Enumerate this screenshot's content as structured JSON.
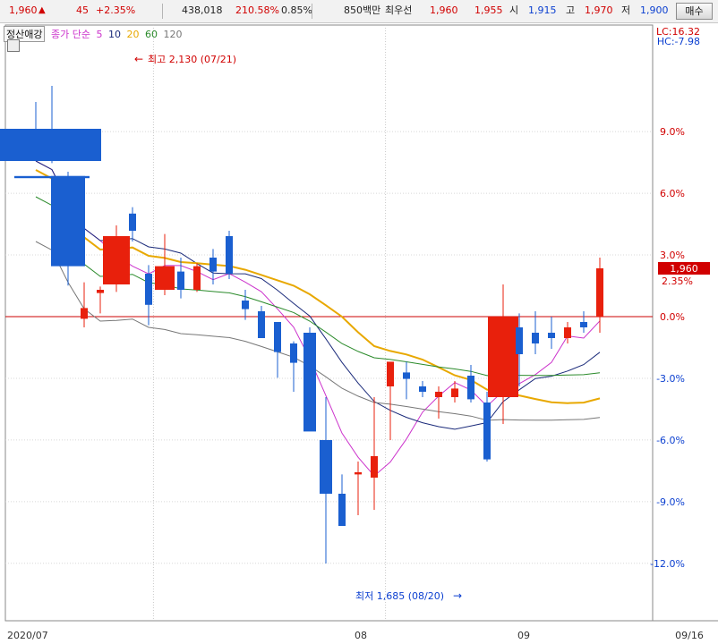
{
  "header": {
    "price": "1,960",
    "up_icon": "up-triangle-icon",
    "change": "45",
    "change_pct": "+2.35%",
    "volume": "438,018",
    "volume_ratio": "210.58%",
    "turnover": "0.85%",
    "amount": "850백만",
    "best_bid_label": "최우선",
    "best_ask": "1,960",
    "best_bid": "1,955",
    "open_label": "시",
    "open": "1,915",
    "high_label": "고",
    "high": "1,970",
    "low_label": "저",
    "low": "1,900",
    "buy_button": "매수"
  },
  "legend": {
    "selector": "정산애강",
    "ma_label": "종가 단순",
    "ma5": "5",
    "ma10": "10",
    "ma20": "20",
    "ma60": "60",
    "ma120": "120"
  },
  "colors": {
    "up": "#e8200c",
    "down": "#1a5fd0",
    "ma5": "#cc33cc",
    "ma10": "#1a2a7a",
    "ma20": "#e8a800",
    "ma60": "#2a8a2a",
    "ma120": "#777777",
    "ref_line": "#cc0000"
  },
  "chart_data": {
    "type": "candlestick",
    "right_axis_ticks": [
      "9.0%",
      "6.0%",
      "3.0%",
      "0.0%",
      "-3.0%",
      "-6.0%",
      "-9.0%",
      "-12.0%"
    ],
    "x_labels": [
      "2020/07",
      "08",
      "09",
      "09/16"
    ],
    "lc_label": "LC:16.32",
    "hc_label": "HC:-7.98",
    "current_price_label": "1,960",
    "current_pct_label": "2.35%",
    "ref_price": 1915,
    "price_max_annotation": "최고 2,130 (07/21)",
    "price_min_annotation": "최저 1,685 (08/20)",
    "candles": [
      {
        "o": 2090,
        "h": 2115,
        "l": 2060,
        "c": 2060
      },
      {
        "o": 2046,
        "h": 2130,
        "l": 2058,
        "c": 2044
      },
      {
        "o": 2046,
        "h": 2050,
        "l": 1944,
        "c": 1962
      },
      {
        "o": 1913,
        "h": 1947,
        "l": 1905,
        "c": 1923
      },
      {
        "o": 1937,
        "h": 1943,
        "l": 1918,
        "c": 1940
      },
      {
        "o": 1945,
        "h": 2000,
        "l": 1938,
        "c": 1990
      },
      {
        "o": 2011,
        "h": 2017,
        "l": 1985,
        "c": 1995
      },
      {
        "o": 1955,
        "h": 1963,
        "l": 1907,
        "c": 1926
      },
      {
        "o": 1940,
        "h": 1992,
        "l": 1935,
        "c": 1962
      },
      {
        "o": 1957,
        "h": 1970,
        "l": 1932,
        "c": 1940
      },
      {
        "o": 1940,
        "h": 1965,
        "l": 1938,
        "c": 1962
      },
      {
        "o": 1970,
        "h": 1978,
        "l": 1945,
        "c": 1957
      },
      {
        "o": 1990,
        "h": 1995,
        "l": 1950,
        "c": 1955
      },
      {
        "o": 1930,
        "h": 1940,
        "l": 1912,
        "c": 1922
      },
      {
        "o": 1920,
        "h": 1925,
        "l": 1895,
        "c": 1895
      },
      {
        "o": 1910,
        "h": 1905,
        "l": 1858,
        "c": 1882
      },
      {
        "o": 1890,
        "h": 1892,
        "l": 1845,
        "c": 1872
      },
      {
        "o": 1900,
        "h": 1905,
        "l": 1820,
        "c": 1808
      },
      {
        "o": 1800,
        "h": 1840,
        "l": 1685,
        "c": 1750
      },
      {
        "o": 1750,
        "h": 1768,
        "l": 1720,
        "c": 1720
      },
      {
        "o": 1768,
        "h": 1780,
        "l": 1730,
        "c": 1770
      },
      {
        "o": 1765,
        "h": 1840,
        "l": 1735,
        "c": 1785
      },
      {
        "o": 1850,
        "h": 1868,
        "l": 1800,
        "c": 1873
      },
      {
        "o": 1863,
        "h": 1873,
        "l": 1838,
        "c": 1857
      },
      {
        "o": 1850,
        "h": 1855,
        "l": 1840,
        "c": 1845
      },
      {
        "o": 1840,
        "h": 1850,
        "l": 1820,
        "c": 1845
      },
      {
        "o": 1840,
        "h": 1855,
        "l": 1835,
        "c": 1848
      },
      {
        "o": 1860,
        "h": 1870,
        "l": 1835,
        "c": 1838
      },
      {
        "o": 1835,
        "h": 1845,
        "l": 1780,
        "c": 1782
      },
      {
        "o": 1840,
        "h": 1945,
        "l": 1815,
        "c": 1915
      },
      {
        "o": 1905,
        "h": 1918,
        "l": 1850,
        "c": 1880
      },
      {
        "o": 1900,
        "h": 1920,
        "l": 1880,
        "c": 1890
      },
      {
        "o": 1900,
        "h": 1915,
        "l": 1885,
        "c": 1895
      },
      {
        "o": 1895,
        "h": 1910,
        "l": 1890,
        "c": 1905
      },
      {
        "o": 1910,
        "h": 1920,
        "l": 1900,
        "c": 1905
      },
      {
        "o": 1915,
        "h": 1970,
        "l": 1900,
        "c": 1960
      }
    ]
  }
}
